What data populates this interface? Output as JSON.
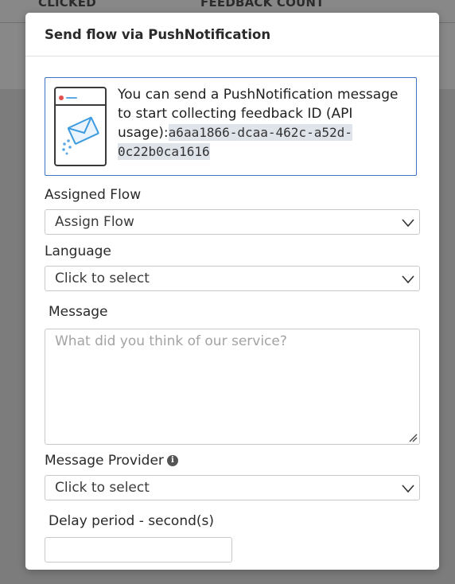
{
  "background": {
    "columns": [
      "CLICKED",
      "FEEDBACK COUNT"
    ]
  },
  "modal": {
    "title": "Send flow via PushNotification",
    "info": {
      "text": "You can send a PushNotification message to start collecting feedback ID (API usage):",
      "api_id": "a6aa1866-dcaa-462c-a52d-0c22b0ca1616",
      "icon": "envelope-notification-icon"
    },
    "assigned_flow": {
      "label": "Assigned Flow",
      "value": "Assign Flow"
    },
    "language": {
      "label": "Language",
      "value": "Click to select"
    },
    "message": {
      "label": "Message",
      "placeholder": "What did you think of our service?"
    },
    "message_provider": {
      "label": "Message Provider",
      "value": "Click to select",
      "info_icon": "i"
    },
    "delay_period": {
      "label": "Delay period - second(s)",
      "value": ""
    }
  },
  "colors": {
    "accent": "#3d72c4",
    "overlay": "#7a7a7a",
    "id_highlight": "#dfe3ea"
  }
}
